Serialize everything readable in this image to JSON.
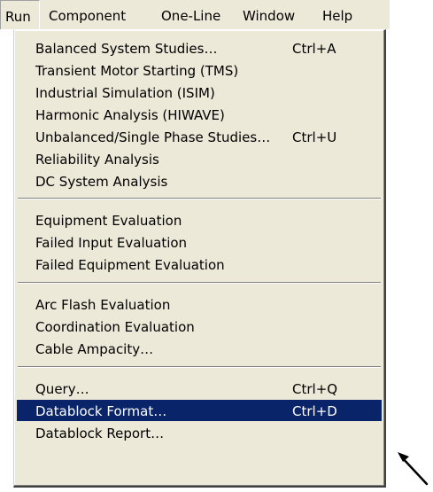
{
  "menubar": {
    "items": [
      {
        "label": "Run"
      },
      {
        "label": "Component"
      },
      {
        "label": "One-Line"
      },
      {
        "label": "Window"
      },
      {
        "label": "Help"
      }
    ]
  },
  "run_menu": {
    "items": [
      {
        "label": "Balanced System Studies…",
        "shortcut": "Ctrl+A"
      },
      {
        "label": "Transient Motor Starting (TMS)",
        "shortcut": ""
      },
      {
        "label": "Industrial Simulation (ISIM)",
        "shortcut": ""
      },
      {
        "label": "Harmonic Analysis (HIWAVE)",
        "shortcut": ""
      },
      {
        "label": "Unbalanced/Single Phase Studies…",
        "shortcut": "Ctrl+U"
      },
      {
        "label": "Reliability Analysis",
        "shortcut": ""
      },
      {
        "label": "DC System Analysis",
        "shortcut": ""
      },
      {
        "label": "Equipment Evaluation",
        "shortcut": ""
      },
      {
        "label": "Failed Input Evaluation",
        "shortcut": ""
      },
      {
        "label": "Failed Equipment Evaluation",
        "shortcut": ""
      },
      {
        "label": "Arc Flash Evaluation",
        "shortcut": ""
      },
      {
        "label": "Coordination Evaluation",
        "shortcut": ""
      },
      {
        "label": "Cable Ampacity…",
        "shortcut": ""
      },
      {
        "label": "Query…",
        "shortcut": "Ctrl+Q"
      },
      {
        "label": "Datablock Format…",
        "shortcut": "Ctrl+D",
        "highlighted": true
      },
      {
        "label": "Datablock Report…",
        "shortcut": ""
      }
    ]
  },
  "colors": {
    "menu_background": "#ece9d8",
    "highlight_background": "#0a246a",
    "highlight_text": "#ffffff"
  },
  "pointer": {
    "icon": "pointer-arrow-icon"
  }
}
